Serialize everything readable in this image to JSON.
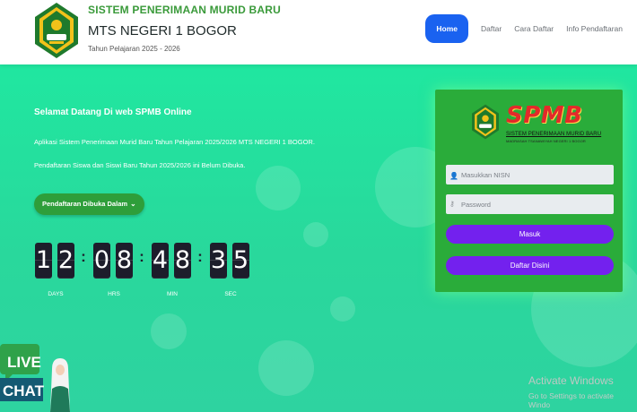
{
  "header": {
    "brand_top": "SISTEM PENERIMAAN MURID BARU",
    "school_name": "MTS NEGERI 1 BOGOR",
    "year": "Tahun Pelajaran 2025 - 2026",
    "nav": [
      "Home",
      "Daftar",
      "Cara Daftar",
      "Info Pendaftaran"
    ]
  },
  "hero": {
    "welcome": "Selamat Datang Di web SPMB Online",
    "desc1": "Aplikasi Sistem Penerimaan Murid Baru Tahun Pelajaran 2025/2026 MTS NEGERI 1 BOGOR.",
    "desc2": "Pendaftaran Siswa dan Siswi Baru Tahun 2025/2026 ini Belum Dibuka.",
    "open_button": "Pendaftaran Dibuka Dalam",
    "countdown": {
      "digits": [
        "1",
        "2",
        "0",
        "8",
        "4",
        "8",
        "3",
        "5"
      ],
      "labels": [
        "DAYS",
        "HRS",
        "MIN",
        "SEC"
      ]
    }
  },
  "login": {
    "logo_text": "SPMB",
    "logo_sub1": "SISTEM PENERIMAAN MURID BARU",
    "logo_sub2": "MADRASAH TSANAWIYAH NEGERI 1 BOGOR",
    "nisn_placeholder": "Masukkan NISN",
    "password_placeholder": "Password",
    "login_button": "Masuk",
    "register_button": "Daftar Disini"
  },
  "live_chat": {
    "line1": "LIVE",
    "line2": "CHAT"
  },
  "watermark": {
    "title": "Activate Windows",
    "subtitle": "Go to Settings to activate Windo"
  },
  "colors": {
    "accent_blue": "#1a62f0",
    "hero_green": "#29d89c",
    "card_green": "#2aac3a",
    "button_purple": "#7321ee"
  }
}
